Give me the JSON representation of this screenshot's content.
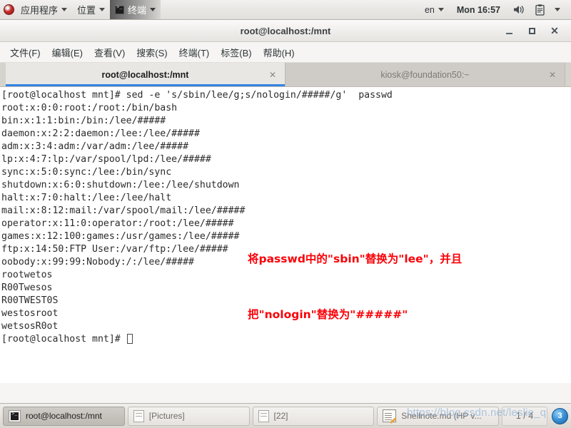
{
  "top_panel": {
    "applications_label": "应用程序",
    "places_label": "位置",
    "active_app_label": "终端",
    "language": "en",
    "clock": "Mon 16:57",
    "volume_icon": "speaker-icon",
    "document_icon": "document-icon"
  },
  "window": {
    "title": "root@localhost:/mnt",
    "minimize_label": "_",
    "maximize_label": "□",
    "close_label": "✕",
    "menus": [
      "文件(F)",
      "编辑(E)",
      "查看(V)",
      "搜索(S)",
      "终端(T)",
      "标签(B)",
      "帮助(H)"
    ],
    "tabs": [
      {
        "label": "root@localhost:/mnt",
        "active": true,
        "close": "✕"
      },
      {
        "label": "kiosk@foundation50:~",
        "active": false,
        "close": "✕"
      }
    ]
  },
  "terminal": {
    "lines": [
      "[root@localhost mnt]# sed -e 's/sbin/lee/g;s/nologin/#####/g'  passwd",
      "root:x:0:0:root:/root:/bin/bash",
      "bin:x:1:1:bin:/bin:/lee/#####",
      "daemon:x:2:2:daemon:/lee:/lee/#####",
      "adm:x:3:4:adm:/var/adm:/lee/#####",
      "lp:x:4:7:lp:/var/spool/lpd:/lee/#####",
      "sync:x:5:0:sync:/lee:/bin/sync",
      "shutdown:x:6:0:shutdown:/lee:/lee/shutdown",
      "halt:x:7:0:halt:/lee:/lee/halt",
      "mail:x:8:12:mail:/var/spool/mail:/lee/#####",
      "operator:x:11:0:operator:/root:/lee/#####",
      "games:x:12:100:games:/usr/games:/lee/#####",
      "ftp:x:14:50:FTP User:/var/ftp:/lee/#####",
      "oobody:x:99:99:Nobody:/:/lee/#####",
      "rootwetos",
      "R00Twesos",
      "R00TWEST0S",
      "westosroot",
      "wetsosR0ot"
    ],
    "prompt": "[root@localhost mnt]# "
  },
  "annotation": {
    "line1": "将passwd中的\"sbin\"替换为\"lee\"，并且",
    "line2": "把\"nologin\"替换为\"#####\"",
    "color": "#fb0007"
  },
  "taskbar": {
    "items": [
      {
        "label": "root@localhost:/mnt",
        "icon": "terminal-icon",
        "active": true
      },
      {
        "label": "[Pictures]",
        "icon": "window-icon",
        "active": false
      },
      {
        "label": "[22]",
        "icon": "window-icon",
        "active": false
      },
      {
        "label": "Shellnote.md (HP v...",
        "icon": "notepad-icon",
        "active": false
      }
    ],
    "page_indicator": "1 / 4",
    "tray_badge": "3"
  },
  "watermark": {
    "text": "https://blog.csdn.net/leslie_q"
  },
  "colors": {
    "accent": "#3584e4",
    "annotation_red": "#fb0007",
    "panel_bg": "#e9e7e4",
    "terminal_bg": "#ffffff",
    "terminal_fg": "#2b2b2b"
  }
}
